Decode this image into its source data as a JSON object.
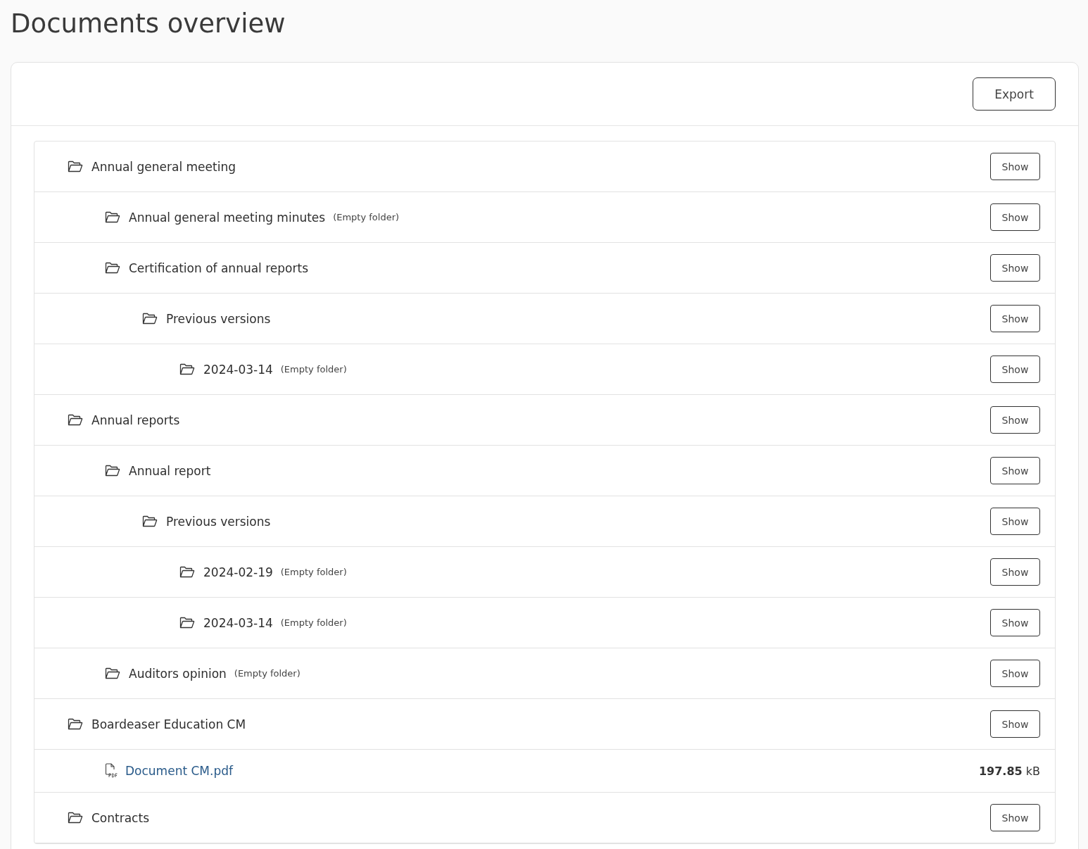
{
  "title": "Documents overview",
  "export_button": "Export",
  "tree": [
    {
      "kind": "folder",
      "name": "Annual general meeting",
      "button": "Show",
      "children": [
        {
          "kind": "folder",
          "name": "Annual general meeting minutes",
          "note": "(Empty folder)",
          "button": "Show"
        },
        {
          "kind": "folder",
          "name": "Certification of annual reports",
          "button": "Show",
          "children": [
            {
              "kind": "folder",
              "name": "Previous versions",
              "button": "Show",
              "children": [
                {
                  "kind": "folder",
                  "name": "2024-03-14",
                  "note": "(Empty folder)",
                  "button": "Show"
                }
              ]
            }
          ]
        }
      ]
    },
    {
      "kind": "folder",
      "name": "Annual reports",
      "button": "Show",
      "children": [
        {
          "kind": "folder",
          "name": "Annual report",
          "button": "Show",
          "children": [
            {
              "kind": "folder",
              "name": "Previous versions",
              "button": "Show",
              "children": [
                {
                  "kind": "folder",
                  "name": "2024-02-19",
                  "note": "(Empty folder)",
                  "button": "Show"
                },
                {
                  "kind": "folder",
                  "name": "2024-03-14",
                  "note": "(Empty folder)",
                  "button": "Show"
                }
              ]
            }
          ]
        },
        {
          "kind": "folder",
          "name": "Auditors opinion",
          "note": "(Empty folder)",
          "button": "Show"
        }
      ]
    },
    {
      "kind": "folder",
      "name": "Boardeaser Education CM",
      "button": "Show",
      "children": [
        {
          "kind": "file",
          "name": "Document CM.pdf",
          "size": "**197.85** kB"
        }
      ]
    },
    {
      "kind": "folder",
      "name": "Contracts",
      "button": "Show"
    }
  ]
}
